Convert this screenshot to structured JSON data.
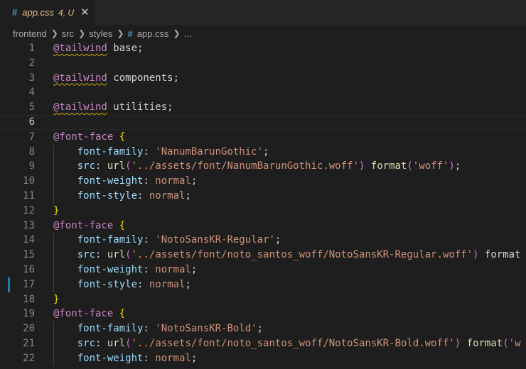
{
  "tab": {
    "icon": "#",
    "filename": "app.css",
    "status": "4, U",
    "close": "✕"
  },
  "breadcrumb": [
    "frontend",
    "src",
    "styles",
    "app.css",
    "..."
  ],
  "editor": {
    "active_line": 6,
    "lines": [
      {
        "n": 1,
        "t": "@tailwind base;"
      },
      {
        "n": 2,
        "t": ""
      },
      {
        "n": 3,
        "t": "@tailwind components;"
      },
      {
        "n": 4,
        "t": ""
      },
      {
        "n": 5,
        "t": "@tailwind utilities;"
      },
      {
        "n": 6,
        "t": ""
      },
      {
        "n": 7,
        "t": "@font-face {"
      },
      {
        "n": 8,
        "t": "    font-family: 'NanumBarunGothic';"
      },
      {
        "n": 9,
        "t": "    src: url('../assets/font/NanumBarunGothic.woff') format('woff');"
      },
      {
        "n": 10,
        "t": "    font-weight: normal;"
      },
      {
        "n": 11,
        "t": "    font-style: normal;"
      },
      {
        "n": 12,
        "t": "}"
      },
      {
        "n": 13,
        "t": "@font-face {"
      },
      {
        "n": 14,
        "t": "    font-family: 'NotoSansKR-Regular';"
      },
      {
        "n": 15,
        "t": "    src: url('../assets/font/noto_santos_woff/NotoSansKR-Regular.woff') format"
      },
      {
        "n": 16,
        "t": "    font-weight: normal;"
      },
      {
        "n": 17,
        "t": "    font-style: normal;"
      },
      {
        "n": 18,
        "t": "}"
      },
      {
        "n": 19,
        "t": "@font-face {"
      },
      {
        "n": 20,
        "t": "    font-family: 'NotoSansKR-Bold';"
      },
      {
        "n": 21,
        "t": "    src: url('../assets/font/noto_santos_woff/NotoSansKR-Bold.woff') format('w"
      },
      {
        "n": 22,
        "t": "    font-weight: normal;"
      }
    ]
  },
  "colors": {
    "background": "#1e1e1e",
    "keyword": "#c586c0",
    "property": "#9cdcfe",
    "string": "#ce9178",
    "function": "#dcdcaa",
    "brace": "#ffd700",
    "paren": "#da70d6",
    "line_number": "#858585",
    "modified_tab": "#e2c08d",
    "css_icon": "#519aba"
  }
}
